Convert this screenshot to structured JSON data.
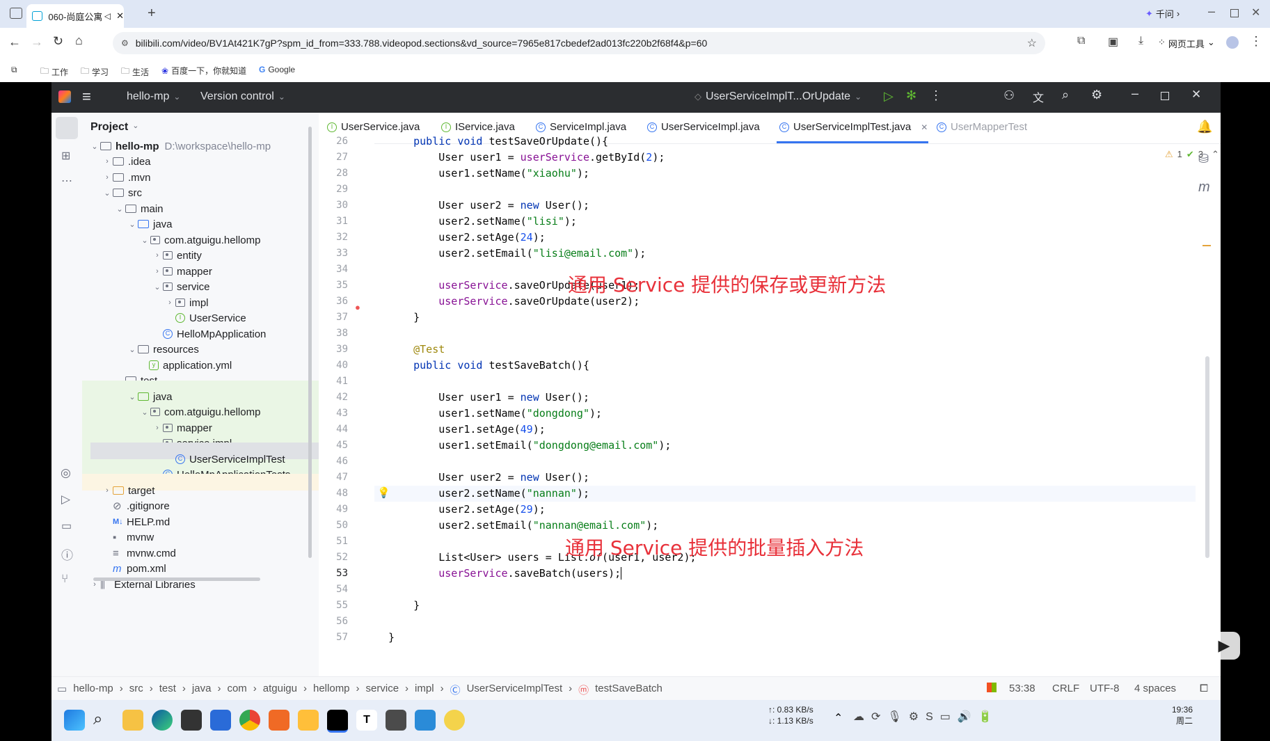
{
  "browser": {
    "tab_title": "060-尚庭公寓",
    "qianwen": "千问",
    "url": "bilibili.com/video/BV1At421K7gP?spm_id_from=333.788.videopod.sections&vd_source=7965e817cbedef2ad013fc220b2f68f4&p=60",
    "web_tools": "网页工具",
    "bookmarks": [
      "工作",
      "学习",
      "生活",
      "百度一下，你就知道",
      "Google"
    ]
  },
  "ide": {
    "project_name": "hello-mp",
    "vcs": "Version control",
    "run_config": "UserServiceImplT...OrUpdate",
    "panel_title": "Project",
    "tree": [
      {
        "label": "hello-mp",
        "extra": "D:\\workspace\\hello-mp"
      },
      {
        "label": ".idea"
      },
      {
        "label": ".mvn"
      },
      {
        "label": "src"
      },
      {
        "label": "main"
      },
      {
        "label": "java"
      },
      {
        "label": "com.atguigu.hellomp"
      },
      {
        "label": "entity"
      },
      {
        "label": "mapper"
      },
      {
        "label": "service"
      },
      {
        "label": "impl"
      },
      {
        "label": "UserService"
      },
      {
        "label": "HelloMpApplication"
      },
      {
        "label": "resources"
      },
      {
        "label": "application.yml"
      },
      {
        "label": "test"
      },
      {
        "label": "java"
      },
      {
        "label": "com.atguigu.hellomp"
      },
      {
        "label": "mapper"
      },
      {
        "label": "service.impl"
      },
      {
        "label": "UserServiceImplTest"
      },
      {
        "label": "HelloMpApplicationTests"
      },
      {
        "label": "target"
      },
      {
        "label": ".gitignore"
      },
      {
        "label": "HELP.md"
      },
      {
        "label": "mvnw"
      },
      {
        "label": "mvnw.cmd"
      },
      {
        "label": "pom.xml"
      },
      {
        "label": "External Libraries"
      }
    ],
    "tabs": [
      "UserService.java",
      "IService.java",
      "ServiceImpl.java",
      "UserServiceImpl.java",
      "UserServiceImplTest.java",
      "UserMapperTest"
    ],
    "inspections": {
      "warnings": "1",
      "ok": "3"
    },
    "line_numbers": [
      "26",
      "27",
      "28",
      "29",
      "30",
      "31",
      "32",
      "33",
      "34",
      "35",
      "36",
      "37",
      "38",
      "39",
      "40",
      "41",
      "42",
      "43",
      "44",
      "45",
      "46",
      "47",
      "48",
      "49",
      "50",
      "51",
      "52",
      "53",
      "54",
      "55",
      "56",
      "57"
    ],
    "overlay_1": "通用 Service 提供的保存或更新方法",
    "overlay_2": "通用 Service 提供的批量插入方法",
    "breadcrumb": [
      "hello-mp",
      "src",
      "test",
      "java",
      "com",
      "atguigu",
      "hellomp",
      "service",
      "impl",
      "UserServiceImplTest",
      "testSaveBatch"
    ],
    "status": {
      "position": "53:38",
      "line_sep": "CRLF",
      "encoding": "UTF-8",
      "indent": "4 spaces"
    }
  },
  "taskbar": {
    "net_up": "↑: 0.83 KB/s",
    "net_down": "↓: 1.13 KB/s",
    "time": "19:36",
    "weekday": "周二"
  },
  "colors": {
    "accent": "#3574f0",
    "overlay_text": "#e8313a",
    "ide_header": "#2b2d30"
  }
}
